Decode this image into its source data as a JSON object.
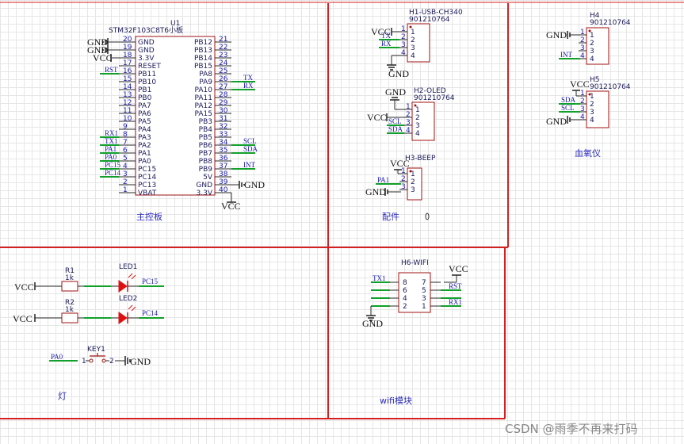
{
  "mcu": {
    "ref": "U1",
    "part": "STM32F103C8T6小板",
    "left_pins": [
      {
        "num": "20",
        "name": "GND"
      },
      {
        "num": "19",
        "name": "GND"
      },
      {
        "num": "18",
        "name": "3.3V"
      },
      {
        "num": "17",
        "name": "RESET"
      },
      {
        "num": "16",
        "name": "PB11"
      },
      {
        "num": "15",
        "name": "PB10"
      },
      {
        "num": "14",
        "name": "PB1"
      },
      {
        "num": "13",
        "name": "PB0"
      },
      {
        "num": "12",
        "name": "PA7"
      },
      {
        "num": "11",
        "name": "PA6"
      },
      {
        "num": "10",
        "name": "PA5"
      },
      {
        "num": "9",
        "name": "PA4"
      },
      {
        "num": "8",
        "name": "PA3"
      },
      {
        "num": "7",
        "name": "PA2"
      },
      {
        "num": "6",
        "name": "PA1"
      },
      {
        "num": "5",
        "name": "PA0"
      },
      {
        "num": "4",
        "name": "PC15"
      },
      {
        "num": "3",
        "name": "PC14"
      },
      {
        "num": "2",
        "name": "PC13"
      },
      {
        "num": "1",
        "name": "VBAT"
      }
    ],
    "right_pins": [
      {
        "num": "21",
        "name": "PB12"
      },
      {
        "num": "22",
        "name": "PB13"
      },
      {
        "num": "23",
        "name": "PB14"
      },
      {
        "num": "24",
        "name": "PB15"
      },
      {
        "num": "25",
        "name": "PA8"
      },
      {
        "num": "26",
        "name": "PA9"
      },
      {
        "num": "27",
        "name": "PA10"
      },
      {
        "num": "28",
        "name": "PA11"
      },
      {
        "num": "29",
        "name": "PA12"
      },
      {
        "num": "30",
        "name": "PA15"
      },
      {
        "num": "31",
        "name": "PB3"
      },
      {
        "num": "32",
        "name": "PB4"
      },
      {
        "num": "33",
        "name": "PB5"
      },
      {
        "num": "34",
        "name": "PB6"
      },
      {
        "num": "35",
        "name": "PB7"
      },
      {
        "num": "36",
        "name": "PB8"
      },
      {
        "num": "37",
        "name": "PB9"
      },
      {
        "num": "38",
        "name": "5V"
      },
      {
        "num": "39",
        "name": "GND"
      },
      {
        "num": "40",
        "name": "3.3V"
      }
    ],
    "left_power": [
      "GND",
      "GND",
      "VCC"
    ],
    "left_nets": [
      "RST",
      "RX1",
      "TX1",
      "PA1",
      "PA0",
      "PC15",
      "PC14"
    ],
    "right_nets": [
      "TX",
      "RX",
      "SCL",
      "SDA",
      "INT"
    ],
    "right_power": [
      "GND",
      "VCC"
    ]
  },
  "labels": {
    "main_board": "主控板",
    "parts": "配件",
    "oximeter": "血氧仪",
    "lamp": "灯",
    "wifi": "wifi模块"
  },
  "h1": {
    "ref": "H1-USB-CH340",
    "part": "901210764",
    "pins": [
      "1",
      "2",
      "3",
      "4"
    ],
    "nets": [
      "VCC",
      "TX",
      "RX",
      "GND"
    ]
  },
  "h2": {
    "ref": "H2-OLED",
    "part": "901210764",
    "pins": [
      "1",
      "2",
      "3",
      "4"
    ],
    "nets": [
      "GND",
      "VCC",
      "SCL",
      "SDA"
    ]
  },
  "h3": {
    "ref": "H3-BEEP",
    "part": "",
    "pins": [
      "1",
      "2",
      "3"
    ],
    "nets": [
      "VCC",
      "PA1",
      "GND"
    ]
  },
  "h4": {
    "ref": "H4",
    "part": "901210764",
    "pins": [
      "1",
      "2",
      "3",
      "4"
    ],
    "nets": [
      "GND",
      "INT"
    ]
  },
  "h5": {
    "ref": "H5",
    "part": "901210764",
    "pins": [
      "1",
      "2",
      "3",
      "4"
    ],
    "nets": [
      "VCC",
      "SDA",
      "SCL",
      "GND"
    ]
  },
  "h6": {
    "ref": "H6-WIFI",
    "left_pins": [
      "8",
      "6",
      "4",
      "2"
    ],
    "right_pins": [
      "7",
      "5",
      "3",
      "1"
    ],
    "nets": [
      "VCC",
      "TX1",
      "RST",
      "RX1",
      "GND"
    ]
  },
  "lamp": {
    "r1": {
      "ref": "R1",
      "value": "1k"
    },
    "r2": {
      "ref": "R2",
      "value": "1k"
    },
    "led1": {
      "ref": "LED1",
      "net": "PC15"
    },
    "led2": {
      "ref": "LED2",
      "net": "PC14"
    },
    "key1": {
      "ref": "KEY1",
      "pin1": "1",
      "pin2": "2",
      "net": "PA0"
    },
    "vcc": "VCC",
    "gnd": "GND"
  },
  "watermark": "CSDN @雨季不再来打码",
  "colors": {
    "frame": "#d42020",
    "wire": "#11a02a",
    "text": "#1a1aa8"
  }
}
